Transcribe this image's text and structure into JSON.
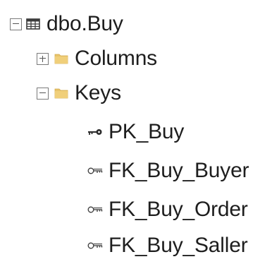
{
  "tree": {
    "table": {
      "label": "dbo.Buy",
      "icon": "table-icon",
      "expanded": true
    },
    "columns": {
      "label": "Columns",
      "icon": "folder-icon",
      "expanded": false
    },
    "keys": {
      "label": "Keys",
      "icon": "folder-icon",
      "expanded": true
    },
    "key_items": [
      {
        "label": "PK_Buy",
        "icon": "primary-key-icon"
      },
      {
        "label": "FK_Buy_Buyer",
        "icon": "foreign-key-icon"
      },
      {
        "label": "FK_Buy_Order",
        "icon": "foreign-key-icon"
      },
      {
        "label": "FK_Buy_Saller",
        "icon": "foreign-key-icon"
      }
    ]
  },
  "colors": {
    "folder": "#e8c46a",
    "expander_border": "#7a7a7a",
    "text": "#1e1e1e"
  }
}
